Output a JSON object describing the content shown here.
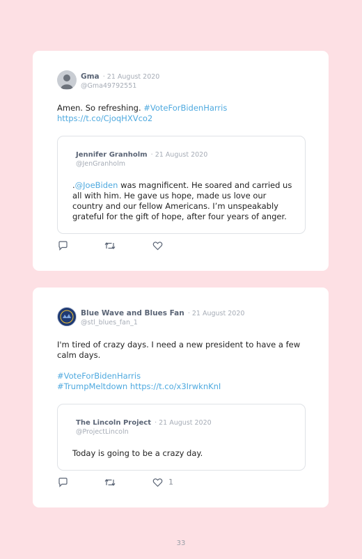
{
  "tweets": [
    {
      "author": "Gma",
      "date": "· 21 August 2020",
      "handle": "@Gma49792551",
      "text": "Amen. So refreshing. ",
      "hashtag": "#VoteForBidenHarris",
      "link": "https://t.co/CjoqHXVco2",
      "avatar_icon": "default-avatar-icon",
      "quote": {
        "author": "Jennifer Granholm",
        "date": "· 21 August 2020",
        "handle": "@JenGranholm",
        "prefix": ".",
        "mention": "@JoeBiden",
        "text": " was magnificent. He soared and carried us all with him. He gave us hope, made us love our country and our fellow Americans. I’m unspeakably grateful for the gift of hope, after four years of anger."
      },
      "likes": ""
    },
    {
      "author": "Blue Wave and Blues Fan",
      "date": "· 21 August 2020",
      "handle": "@stl_blues_fan_1",
      "text": "I'm tired of crazy days. I need a new president to have a few calm days.",
      "hashtag1": "#VoteForBidenHarris",
      "hashtag2": "#TrumpMeltdown",
      "link": "https://t.co/x3IrwknKnI",
      "avatar_icon": "blues-logo-avatar-icon",
      "quote": {
        "author": "The Lincoln Project",
        "date": "· 21 August 2020",
        "handle": "@ProjectLincoln",
        "text": "Today is going to be a crazy day."
      },
      "likes": "1"
    }
  ],
  "icons": [
    "reply-icon",
    "retweet-icon",
    "like-icon"
  ],
  "colors": {
    "background": "#fde0e4",
    "link": "#4ea9df",
    "card": "#ffffff"
  },
  "page_number": "33"
}
